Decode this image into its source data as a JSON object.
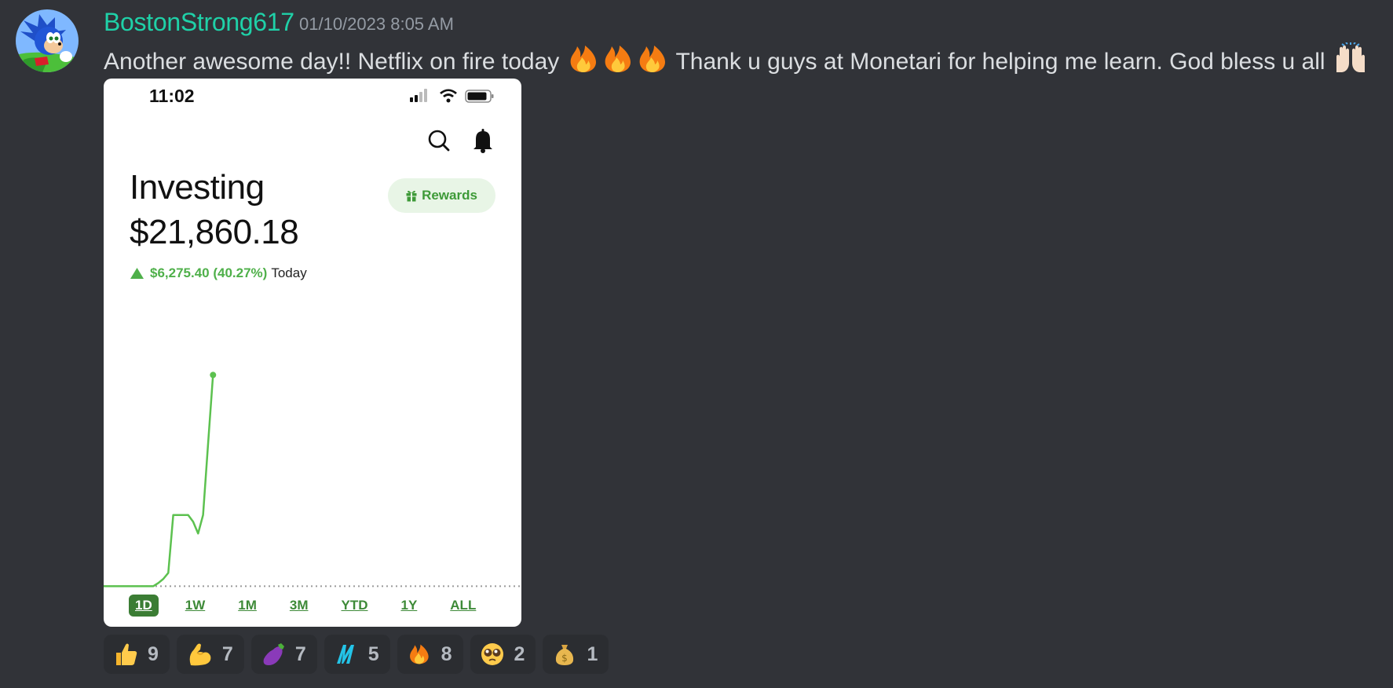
{
  "message": {
    "username": "BostonStrong617",
    "timestamp": "01/10/2023 8:05 AM",
    "text_part1": "Another awesome day!! Netflix on fire today",
    "text_part2": "Thank u guys at Monetari for helping me learn. God bless u all",
    "avatar_icon": "sonic-hedgehog-avatar"
  },
  "screenshot": {
    "status_time": "11:02",
    "title": "Investing",
    "balance": "$21,860.18",
    "rewards_label": "Rewards",
    "change_value": "$6,275.40 (40.27%)",
    "change_label": "Today",
    "ranges": [
      "1D",
      "1W",
      "1M",
      "3M",
      "YTD",
      "1Y",
      "ALL"
    ],
    "active_range": "1D",
    "accent_color": "#4fb04a"
  },
  "chart_data": {
    "type": "line",
    "title": "",
    "xlabel": "",
    "ylabel": "",
    "x": [
      0,
      5,
      10,
      15,
      20,
      22,
      24,
      26,
      28,
      30,
      32,
      34,
      36,
      38,
      40,
      42,
      44,
      46,
      48,
      50
    ],
    "values": [
      15585,
      15585,
      15585,
      15585,
      15585,
      15680,
      15800,
      15980,
      17700,
      17700,
      17700,
      17700,
      17500,
      17150,
      17700,
      19800,
      21860,
      21860,
      21860,
      21860
    ],
    "baseline": 15585,
    "ylim": [
      15500,
      22500
    ],
    "grid": false
  },
  "reactions": [
    {
      "emoji": "thumbs-up-icon",
      "count": "9"
    },
    {
      "emoji": "flexed-biceps-icon",
      "count": "7"
    },
    {
      "emoji": "eggplant-icon",
      "count": "7"
    },
    {
      "emoji": "monetari-logo-icon",
      "count": "5"
    },
    {
      "emoji": "fire-icon",
      "count": "8"
    },
    {
      "emoji": "pleading-face-icon",
      "count": "2"
    },
    {
      "emoji": "money-bag-icon",
      "count": "1"
    }
  ]
}
